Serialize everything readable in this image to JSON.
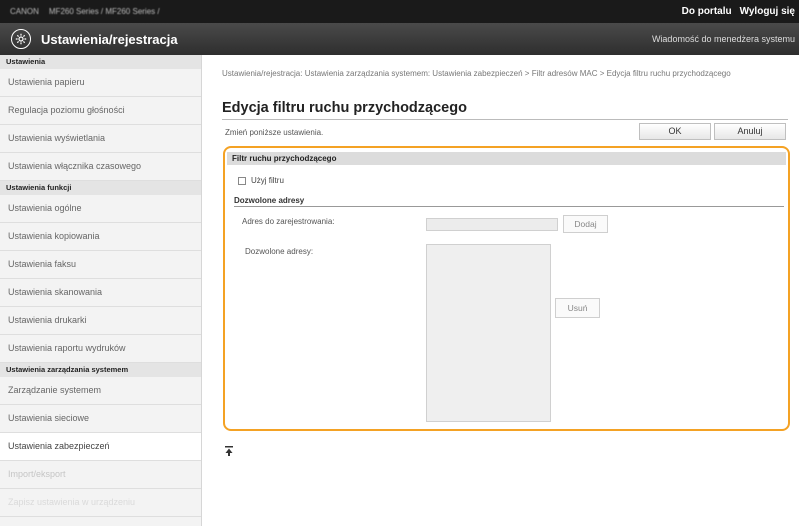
{
  "topbar": {
    "brand": "CANON",
    "device": "MF260 Series / MF260 Series /",
    "portal_link": "Do portalu",
    "logout_link": "Wyloguj się"
  },
  "header": {
    "title": "Ustawienia/rejestracja",
    "message": "Wiadomość do menedżera systemu"
  },
  "sidebar": {
    "sections": [
      {
        "heading": "Ustawienia",
        "items": [
          {
            "label": "Ustawienia papieru"
          },
          {
            "label": "Regulacja poziomu głośności"
          },
          {
            "label": "Ustawienia wyświetlania"
          },
          {
            "label": "Ustawienia włącznika czasowego"
          }
        ]
      },
      {
        "heading": "Ustawienia funkcji",
        "items": [
          {
            "label": "Ustawienia ogólne"
          },
          {
            "label": "Ustawienia kopiowania"
          },
          {
            "label": "Ustawienia faksu"
          },
          {
            "label": "Ustawienia skanowania"
          },
          {
            "label": "Ustawienia drukarki"
          },
          {
            "label": "Ustawienia raportu wydruków"
          }
        ]
      },
      {
        "heading": "Ustawienia zarządzania systemem",
        "items": [
          {
            "label": "Zarządzanie systemem"
          },
          {
            "label": "Ustawienia sieciowe"
          },
          {
            "label": "Ustawienia zabezpieczeń"
          },
          {
            "label": "Import/eksport"
          },
          {
            "label": "Zapisz ustawienia w urządzeniu"
          }
        ]
      }
    ]
  },
  "main": {
    "breadcrumb": "Ustawienia/rejestracja: Ustawienia zarządzania systemem: Ustawienia zabezpieczeń > Filtr adresów MAC > Edycja filtru ruchu przychodzącego",
    "title": "Edycja filtru ruchu przychodzącego",
    "instruction": "Zmień poniższe ustawienia.",
    "ok_label": "OK",
    "cancel_label": "Anuluj",
    "section_title": "Filtr ruchu przychodzącego",
    "use_filter_label": "Użyj filtru",
    "use_filter_checked": false,
    "allowed_heading": "Dozwolone adresy",
    "register_label": "Adres do zarejestrowania:",
    "register_value": "",
    "add_label": "Dodaj",
    "allowed_list_label": "Dozwolone adresy:",
    "allowed_list": [],
    "remove_label": "Usuń",
    "to_top_icon": "to-top-icon"
  },
  "colors": {
    "highlight": "#f4a224",
    "header_bg": "#3a3a3a",
    "topbar_bg": "#1a1a1a"
  }
}
